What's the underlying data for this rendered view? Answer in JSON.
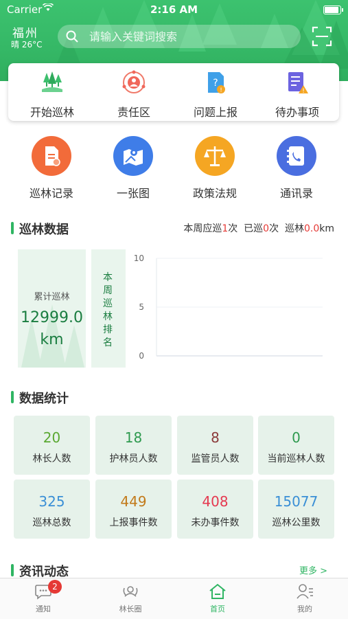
{
  "status_bar": {
    "carrier": "Carrier",
    "time": "2:16 AM"
  },
  "header": {
    "city": "福州",
    "weather": "晴 26°C",
    "search_placeholder": "请输入关键词搜索"
  },
  "quick_actions": [
    {
      "label": "开始巡林",
      "icon": "tree-icon"
    },
    {
      "label": "责任区",
      "icon": "target-icon"
    },
    {
      "label": "问题上报",
      "icon": "report-icon"
    },
    {
      "label": "待办事项",
      "icon": "todo-icon"
    }
  ],
  "features": [
    {
      "label": "巡林记录",
      "icon": "document-icon",
      "color": "#f26b3a"
    },
    {
      "label": "一张图",
      "icon": "map-icon",
      "color": "#3f7de8"
    },
    {
      "label": "政策法规",
      "icon": "scale-icon",
      "color": "#f5a623"
    },
    {
      "label": "通讯录",
      "icon": "contacts-icon",
      "color": "#4a6ee0"
    }
  ],
  "patrol": {
    "title": "巡林数据",
    "week_should_label": "本周应巡",
    "week_should_value": "1",
    "week_should_unit": "次",
    "done_label": "已巡",
    "done_value": "0",
    "done_unit": "次",
    "dist_label": "巡林",
    "dist_value": "0.0",
    "dist_unit": "km",
    "cumulative_label": "累计巡林",
    "cumulative_value": "12999.0",
    "cumulative_unit": "km",
    "rank_label": "本周巡林排名"
  },
  "chart_data": {
    "type": "bar",
    "categories": [],
    "values": [],
    "title": "",
    "xlabel": "",
    "ylabel": "",
    "ylim": [
      0,
      10
    ],
    "yticks": [
      "0",
      "5",
      "10"
    ]
  },
  "stats": {
    "title": "数据统计",
    "items": [
      {
        "value": "20",
        "label": "林长人数",
        "color": "#5aa832"
      },
      {
        "value": "18",
        "label": "护林员人数",
        "color": "#2e9a4f"
      },
      {
        "value": "8",
        "label": "监管员人数",
        "color": "#8b3a3a"
      },
      {
        "value": "0",
        "label": "当前巡林人数",
        "color": "#2e9a4f"
      },
      {
        "value": "325",
        "label": "巡林总数",
        "color": "#3a8fd6"
      },
      {
        "value": "449",
        "label": "上报事件数",
        "color": "#c27a1a"
      },
      {
        "value": "408",
        "label": "未办事件数",
        "color": "#e53950"
      },
      {
        "value": "15077",
        "label": "巡林公里数",
        "color": "#3a8fd6"
      }
    ]
  },
  "news": {
    "title": "资讯动态",
    "more": "更多 >"
  },
  "tabbar": [
    {
      "label": "通知",
      "icon": "chat-icon",
      "badge": "2"
    },
    {
      "label": "林长圈",
      "icon": "circle-group-icon"
    },
    {
      "label": "首页",
      "icon": "home-icon",
      "active": true
    },
    {
      "label": "我的",
      "icon": "profile-icon"
    }
  ]
}
